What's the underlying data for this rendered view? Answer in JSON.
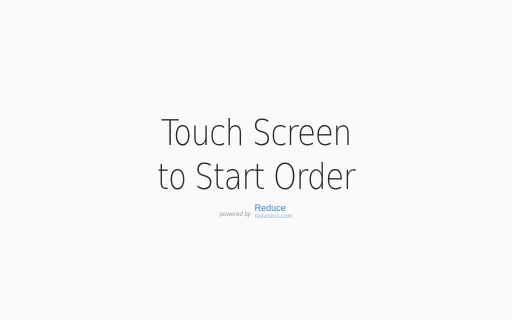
{
  "prompt": {
    "line1": "Touch Screen",
    "line2": "to Start Order"
  },
  "footer": {
    "powered_by": "powered by",
    "brand_name": "Reduce",
    "brand_url": "reduceus.com"
  },
  "colors": {
    "background": "#fafafa",
    "text": "#2a2a2a",
    "brand": "#3b82c4"
  }
}
